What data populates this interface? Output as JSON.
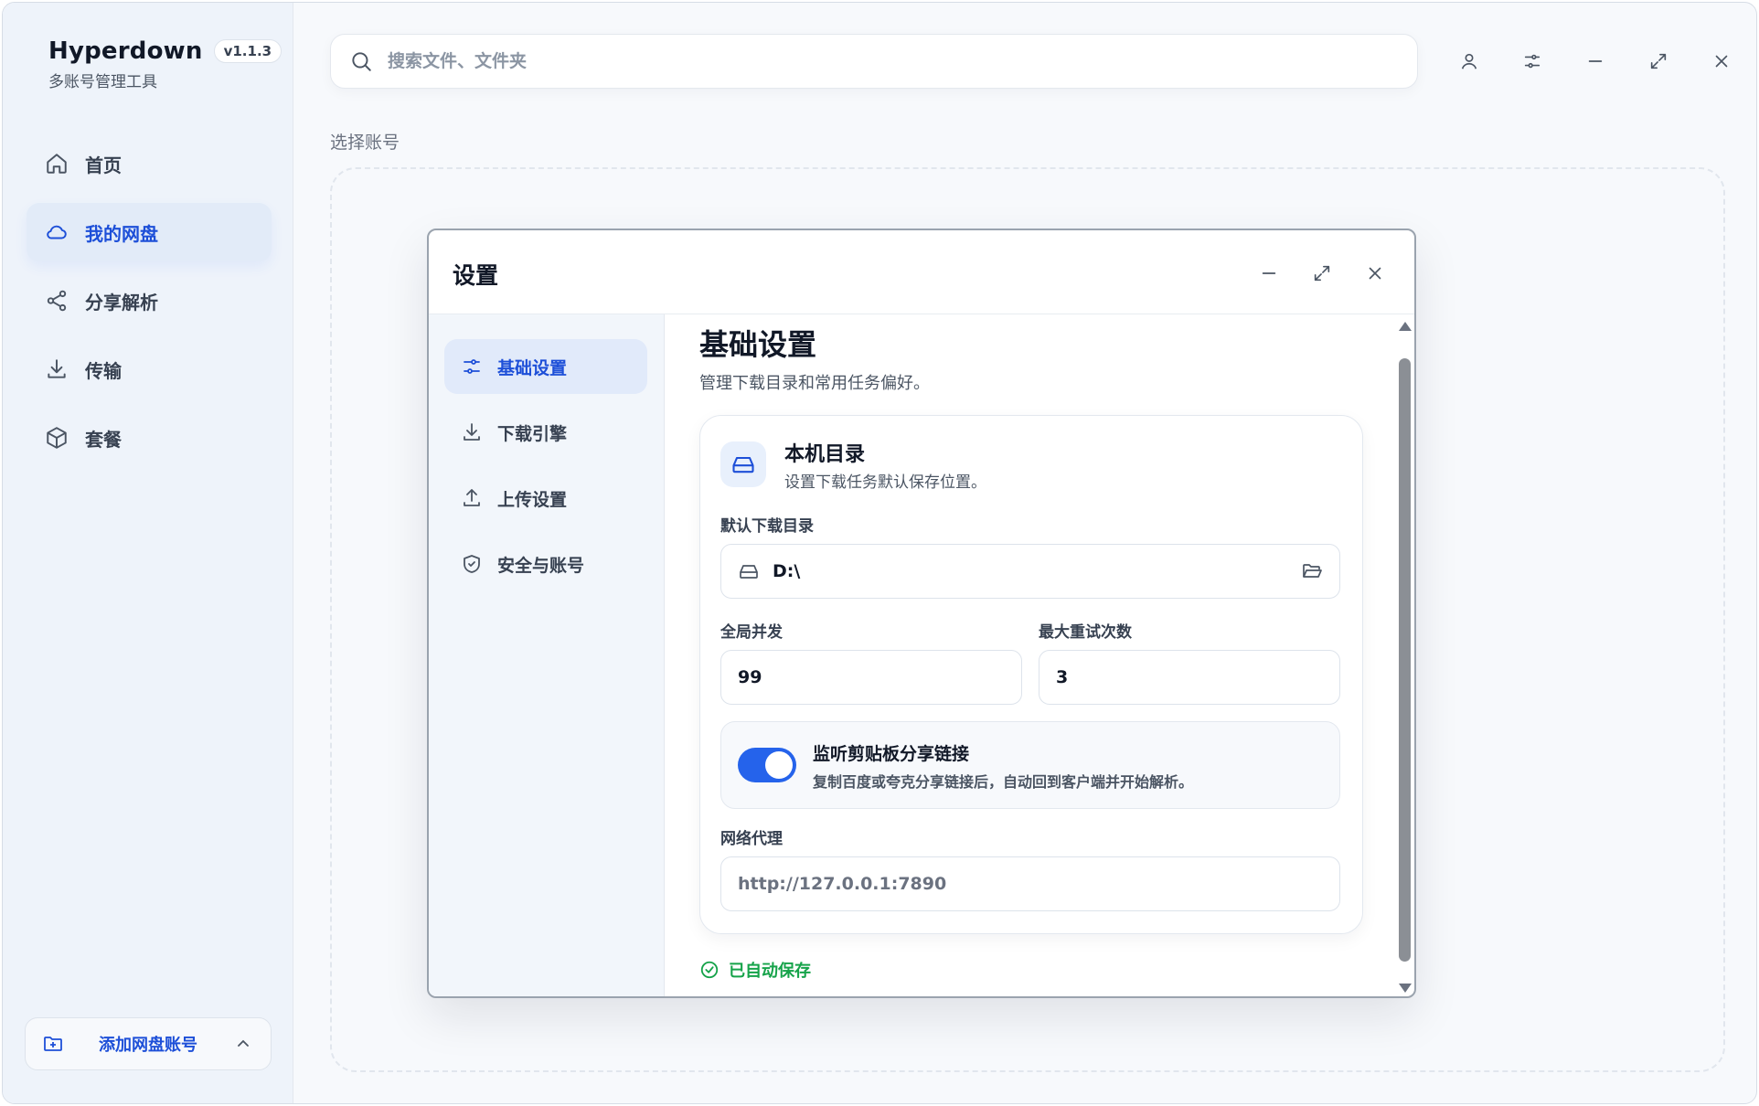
{
  "app": {
    "name": "Hyperdown",
    "version": "v1.1.3",
    "subtitle": "多账号管理工具"
  },
  "sidebar": {
    "items": [
      {
        "label": "首页",
        "icon": "home-icon"
      },
      {
        "label": "我的网盘",
        "icon": "cloud-icon",
        "active": true
      },
      {
        "label": "分享解析",
        "icon": "share-icon"
      },
      {
        "label": "传输",
        "icon": "download-icon"
      },
      {
        "label": "套餐",
        "icon": "package-icon"
      }
    ],
    "add_account": "添加网盘账号"
  },
  "search": {
    "placeholder": "搜索文件、文件夹"
  },
  "top_icons": [
    "user-icon",
    "filter-icon",
    "minimize-icon",
    "maximize-icon",
    "close-icon"
  ],
  "main": {
    "section_label": "选择账号"
  },
  "settings": {
    "title": "设置",
    "nav": [
      {
        "label": "基础设置",
        "icon": "sliders-icon",
        "active": true
      },
      {
        "label": "下载引擎",
        "icon": "download-icon"
      },
      {
        "label": "上传设置",
        "icon": "upload-icon"
      },
      {
        "label": "安全与账号",
        "icon": "shield-icon"
      }
    ],
    "content": {
      "title": "基础设置",
      "description": "管理下载目录和常用任务偏好。",
      "card": {
        "title": "本机目录",
        "subtitle": "设置下载任务默认保存位置。",
        "default_dir_label": "默认下载目录",
        "default_dir_value": "D:\\",
        "concurrency_label": "全局并发",
        "concurrency_value": "99",
        "retry_label": "最大重试次数",
        "retry_value": "3",
        "clipboard_title": "监听剪贴板分享链接",
        "clipboard_desc": "复制百度或夸克分享链接后，自动回到客户端并开始解析。",
        "clipboard_enabled": true,
        "proxy_label": "网络代理",
        "proxy_placeholder": "http://127.0.0.1:7890"
      },
      "saved_status": "已自动保存"
    }
  },
  "colors": {
    "accent": "#2563eb",
    "success": "#16a34a"
  }
}
